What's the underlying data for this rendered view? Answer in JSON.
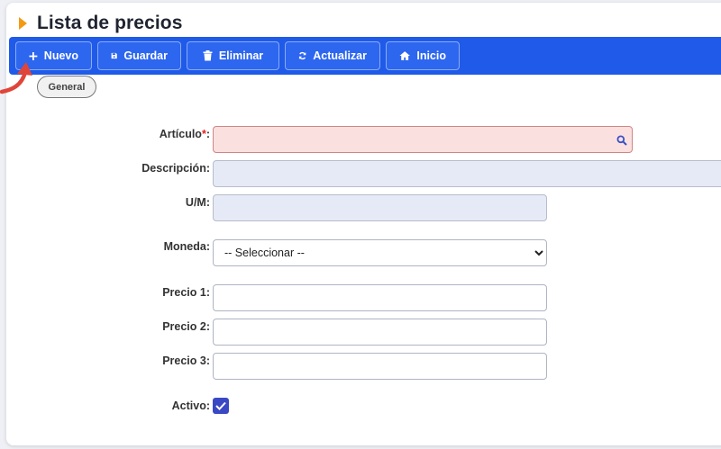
{
  "header": {
    "title": "Lista de precios"
  },
  "toolbar": {
    "new_label": "Nuevo",
    "save_label": "Guardar",
    "delete_label": "Eliminar",
    "refresh_label": "Actualizar",
    "home_label": "Inicio"
  },
  "tabs": {
    "general": "General"
  },
  "form": {
    "articulo_label": "Artículo",
    "articulo_required": "*",
    "articulo_colon": ":",
    "descripcion_label": "Descripción:",
    "um_label": "U/M:",
    "moneda_label": "Moneda:",
    "moneda_selected": "-- Seleccionar --",
    "precio1_label": "Precio 1:",
    "precio2_label": "Precio 2:",
    "precio3_label": "Precio 3:",
    "activo_label": "Activo:",
    "activo_checked": true
  },
  "colors": {
    "toolbar": "#1f5ae8",
    "accent_arrow": "#f39a13",
    "error_field": "#fbe0e0",
    "readonly_field": "#e6eaf6",
    "pointer_arrow": "#e0453a",
    "checkbox": "#3a48c4"
  },
  "icons": {
    "new": "plus-icon",
    "save": "floppy-icon",
    "delete": "trash-icon",
    "refresh": "refresh-icon",
    "home": "home-icon",
    "search": "search-icon"
  }
}
